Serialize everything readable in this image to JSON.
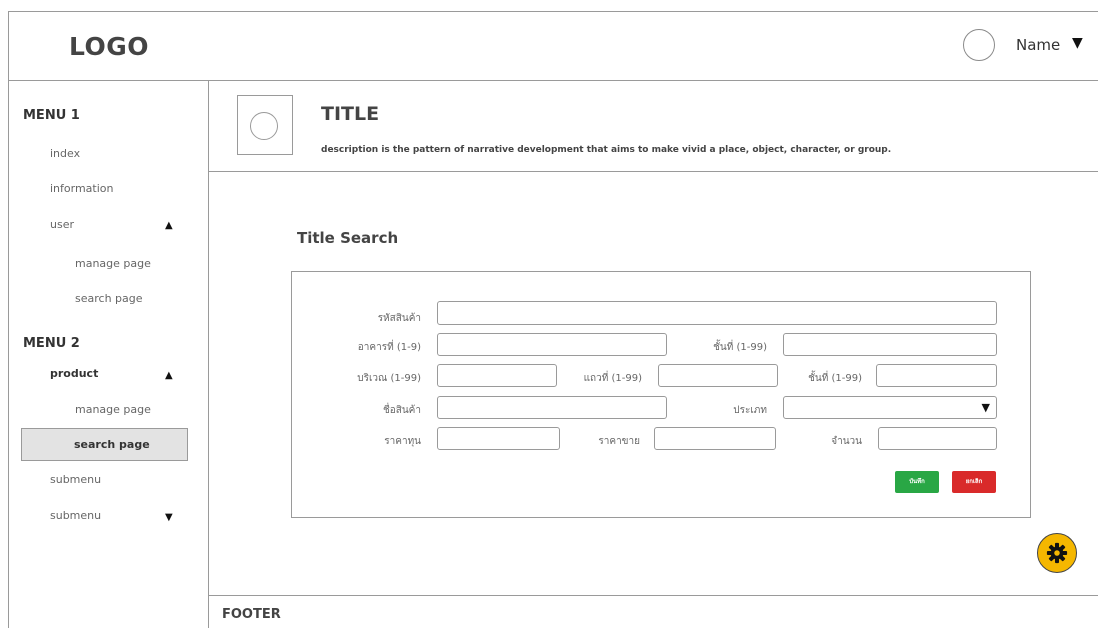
{
  "header": {
    "logo": "LOGO",
    "user_name": "Name"
  },
  "sidebar": {
    "menu1": {
      "title": "MENU 1",
      "items": [
        "index",
        "information",
        "user"
      ],
      "subitems": [
        "manage page",
        "search page"
      ]
    },
    "menu2": {
      "title": "MENU 2",
      "items": [
        "product"
      ],
      "subitems": [
        "manage page",
        "search page"
      ],
      "more": [
        "submenu",
        "submenu"
      ]
    },
    "active_item": "search page"
  },
  "page": {
    "title": "TITLE",
    "description": "description is the pattern of narrative development that aims to make vivid a place, object, character, or group."
  },
  "search": {
    "title": "Title Search",
    "labels": {
      "product_code": "รหัสสินค้า",
      "building": "อาคารที่ (1-9)",
      "floor": "ชั้นที่ (1-99)",
      "area": "บริเวณ (1-99)",
      "row": "แถวที่ (1-99)",
      "floor2": "ชั้นที่ (1-99)",
      "product_name": "ชื่อสินค้า",
      "type": "ประเภท",
      "cost_price": "ราคาทุน",
      "sell_price": "ราคาขาย",
      "quantity": "จำนวน"
    },
    "buttons": {
      "save": "บันทึก",
      "cancel": "ยกเลิก"
    }
  },
  "footer": {
    "text": "FOOTER"
  },
  "colors": {
    "save": "#29a745",
    "cancel": "#d92a2a",
    "fab": "#f5b700",
    "active_bg": "#e3e3e3"
  }
}
